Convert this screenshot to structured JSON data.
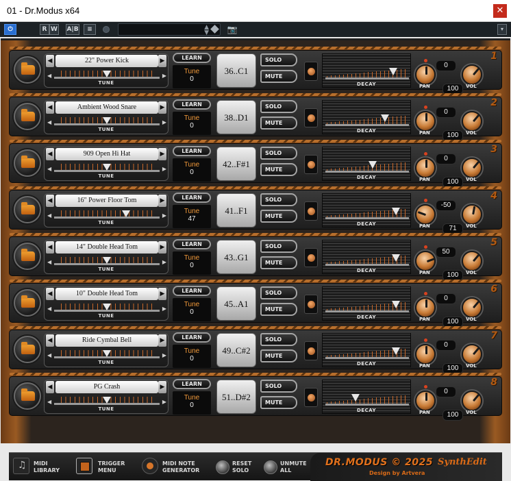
{
  "window": {
    "title": "01 - Dr.Modus x64",
    "close_glyph": "✕"
  },
  "toolbar": {
    "power_glyph": "⏻",
    "read_label": "R",
    "write_label": "W",
    "compare_label": "A|B",
    "menu_glyph": "≡",
    "preset_value": "",
    "camera_glyph": "📷",
    "dropdown_glyph": "▾"
  },
  "labels": {
    "learn": "LEARN",
    "tune_box": "Tune",
    "tune_slider": "TUNE",
    "solo": "SOLO",
    "mute": "MUTE",
    "decay": "DECAY",
    "pan": "PAN",
    "vol": "VOL"
  },
  "channels": [
    {
      "number": "1",
      "sample": "22\" Power Kick",
      "tune": "0",
      "tune_pos": 0.5,
      "note": "36..C1",
      "decay_pos": 0.82,
      "pan": "0",
      "vol": "100",
      "pan_angle": 0,
      "vol_angle": 40
    },
    {
      "number": "2",
      "sample": "Ambient Wood Snare",
      "tune": "0",
      "tune_pos": 0.5,
      "note": "38..D1",
      "decay_pos": 0.72,
      "pan": "0",
      "vol": "100",
      "pan_angle": 0,
      "vol_angle": 40
    },
    {
      "number": "3",
      "sample": "909 Open Hi Hat",
      "tune": "0",
      "tune_pos": 0.5,
      "note": "42..F#1",
      "decay_pos": 0.57,
      "pan": "0",
      "vol": "100",
      "pan_angle": 0,
      "vol_angle": 40
    },
    {
      "number": "4",
      "sample": "16\" Power Floor Tom",
      "tune": "47",
      "tune_pos": 0.71,
      "note": "41..F1",
      "decay_pos": 0.86,
      "pan": "-50",
      "vol": "71",
      "pan_angle": -70,
      "vol_angle": 10
    },
    {
      "number": "5",
      "sample": "14\" Double Head Tom",
      "tune": "0",
      "tune_pos": 0.5,
      "note": "43..G1",
      "decay_pos": 0.86,
      "pan": "50",
      "vol": "100",
      "pan_angle": 70,
      "vol_angle": 40
    },
    {
      "number": "6",
      "sample": "10\" Double Head Tom",
      "tune": "0",
      "tune_pos": 0.5,
      "note": "45..A1",
      "decay_pos": 0.86,
      "pan": "0",
      "vol": "100",
      "pan_angle": 0,
      "vol_angle": 40
    },
    {
      "number": "7",
      "sample": "Ride Cymbal Bell",
      "tune": "0",
      "tune_pos": 0.5,
      "note": "49..C#2",
      "decay_pos": 0.86,
      "pan": "0",
      "vol": "100",
      "pan_angle": 0,
      "vol_angle": 40
    },
    {
      "number": "8",
      "sample": "PG Crash",
      "tune": "0",
      "tune_pos": 0.5,
      "note": "51..D#2",
      "decay_pos": 0.36,
      "pan": "0",
      "vol": "100",
      "pan_angle": 0,
      "vol_angle": 40
    }
  ],
  "footer": {
    "midi_library": "MIDI\nLIBRARY",
    "trigger_menu": "TRIGGER\nMENU",
    "midi_note_generator": "MIDI NOTE\nGENERATOR",
    "reset_solo": "RESET\nSOLO",
    "unmute_all": "UNMUTE\nALL",
    "logo": "DR.MODUS © 2025",
    "brand": "SynthEdit",
    "credit": "Design by Artvera"
  },
  "colors": {
    "accent": "#e0701c",
    "frame": "#9a5a22",
    "panel": "#2c2c2c"
  }
}
